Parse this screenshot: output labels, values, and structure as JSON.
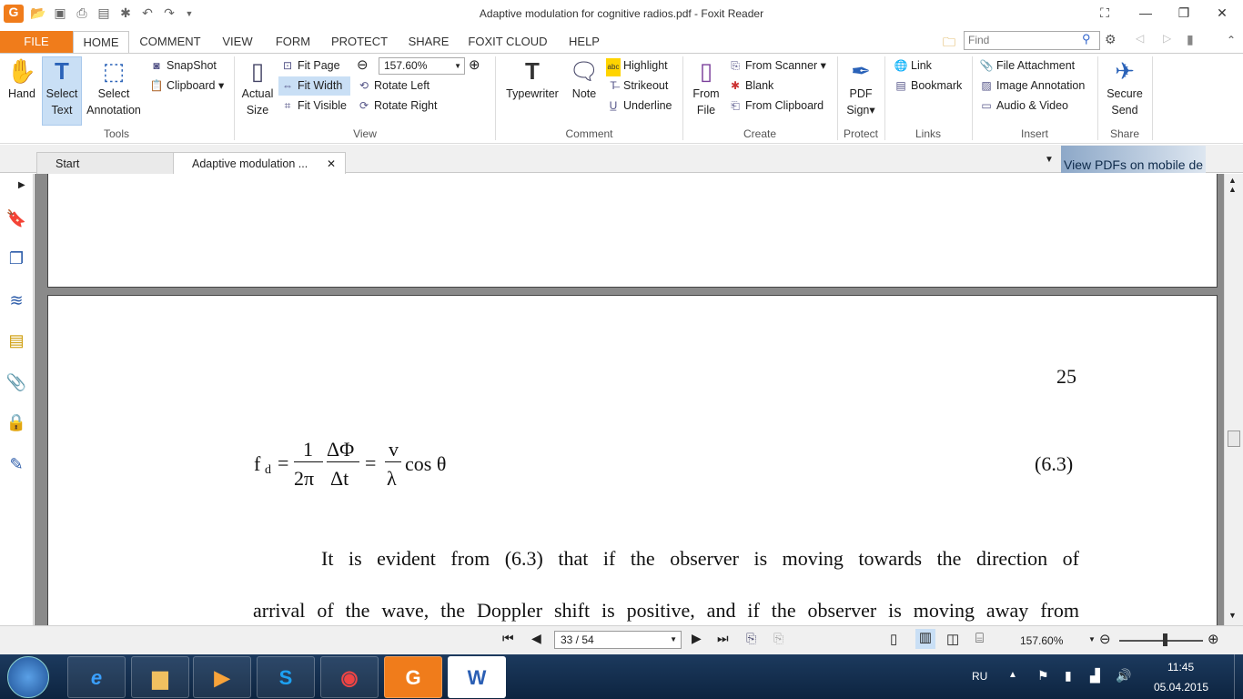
{
  "window": {
    "title": "Adaptive modulation for cognitive radios.pdf - Foxit Reader"
  },
  "ribbon_tabs": [
    "FILE",
    "HOME",
    "COMMENT",
    "VIEW",
    "FORM",
    "PROTECT",
    "SHARE",
    "FOXIT CLOUD",
    "HELP"
  ],
  "find": {
    "placeholder": "Find"
  },
  "tools": {
    "hand": "Hand",
    "select_text_1": "Select",
    "select_text_2": "Text",
    "select_ann_1": "Select",
    "select_ann_2": "Annotation",
    "snapshot": "SnapShot",
    "clipboard": "Clipboard",
    "group": "Tools"
  },
  "view": {
    "actual_1": "Actual",
    "actual_2": "Size",
    "fit_page": "Fit Page",
    "fit_width": "Fit Width",
    "fit_visible": "Fit Visible",
    "zoom": "157.60%",
    "rotate_left": "Rotate Left",
    "rotate_right": "Rotate Right",
    "group": "View"
  },
  "comment": {
    "typewriter": "Typewriter",
    "note": "Note",
    "highlight": "Highlight",
    "strikeout": "Strikeout",
    "underline": "Underline",
    "group": "Comment"
  },
  "create": {
    "from_file_1": "From",
    "from_file_2": "File",
    "from_scanner": "From Scanner",
    "blank": "Blank",
    "from_clipboard": "From Clipboard",
    "group": "Create"
  },
  "protect": {
    "pdf_sign_1": "PDF",
    "pdf_sign_2": "Sign",
    "group": "Protect"
  },
  "links": {
    "link": "Link",
    "bookmark": "Bookmark",
    "group": "Links"
  },
  "insert": {
    "file_attachment": "File Attachment",
    "image_annotation": "Image Annotation",
    "audio_video": "Audio & Video",
    "group": "Insert"
  },
  "share": {
    "secure_1": "Secure",
    "secure_2": "Send",
    "group": "Share"
  },
  "doc_tabs": {
    "start": "Start",
    "current": "Adaptive modulation ..."
  },
  "banner": "View PDFs on mobile de",
  "document": {
    "page_number": "25",
    "eq_label": "(6.3)",
    "body_line1": "It is evident from (6.3) that if the observer is moving towards the direction of",
    "body_line2": "arrival of the wave, the Doppler shift is positive, and if the observer is moving away from"
  },
  "status": {
    "page": "33 / 54",
    "zoom": "157.60%"
  },
  "taskbar": {
    "lang": "RU",
    "time": "11:45",
    "date": "05.04.2015"
  }
}
